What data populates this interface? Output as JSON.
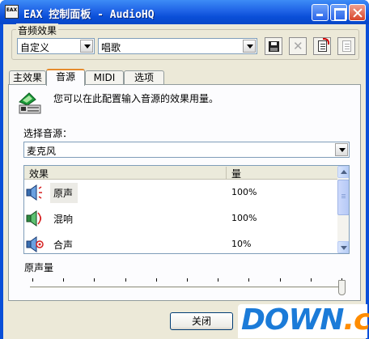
{
  "window": {
    "title": "EAX 控制面板 - AudioHQ",
    "app_icon_text": "EAX",
    "controls": [
      "minimize",
      "maximize",
      "close"
    ]
  },
  "preset_group": {
    "label": "音频效果",
    "category_value": "自定义",
    "preset_value": "唱歌",
    "buttons": [
      "save-icon",
      "delete-icon",
      "new-doc-icon",
      "copy-doc-icon"
    ]
  },
  "tabs": [
    {
      "label": "主效果",
      "active": false
    },
    {
      "label": "音源",
      "active": true
    },
    {
      "label": "MIDI",
      "active": false
    },
    {
      "label": "选项",
      "active": false
    }
  ],
  "source_tab": {
    "description": "您可以在此配置输入音源的效果用量。",
    "source_label": "选择音源：",
    "source_value": "麦克风",
    "columns": [
      "效果",
      "量"
    ],
    "effects": [
      {
        "name": "原声",
        "amount": "100%",
        "icon": "speaker-dry-icon",
        "selected": true
      },
      {
        "name": "混响",
        "amount": "100%",
        "icon": "speaker-reverb-icon",
        "selected": false
      },
      {
        "name": "合声",
        "amount": "10%",
        "icon": "speaker-chorus-icon",
        "selected": false
      }
    ],
    "volume_label": "原声量",
    "volume_level": 1.0
  },
  "footer": {
    "close_label": "关闭"
  },
  "watermark": {
    "main": "DOWN",
    "dot": ".",
    "suffix": "cc"
  },
  "colors": {
    "titlebar": "#0a4fd8",
    "dialog_bg": "#ece9d8",
    "tab_active_accent": "#e68b2c",
    "watermark_blue": "#1b7bd8",
    "watermark_orange": "#ff8c00"
  }
}
